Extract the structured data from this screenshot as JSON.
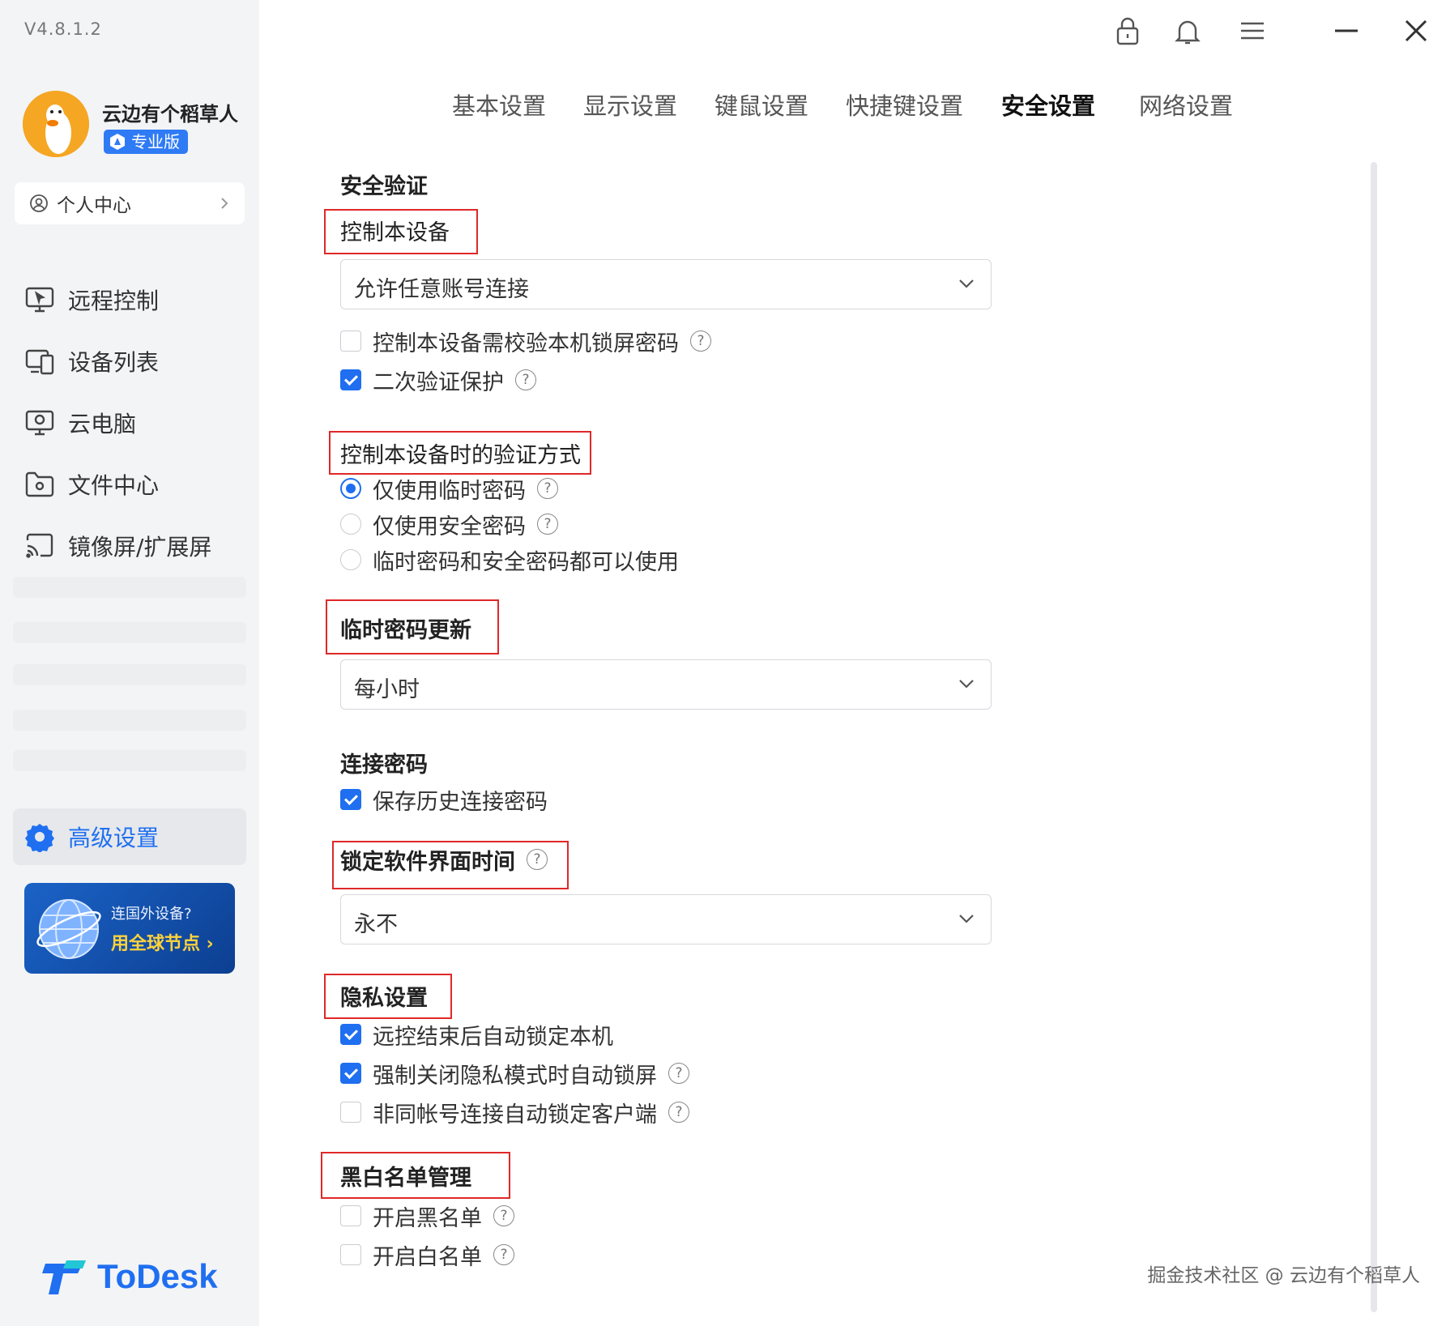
{
  "app": {
    "version": "V4.8.1.2",
    "logo_text": "ToDesk"
  },
  "user": {
    "name": "云边有个稻草人",
    "badge": "专业版",
    "profile_link": "个人中心"
  },
  "sidebar": {
    "items": [
      {
        "label": "远程控制",
        "icon": "remote-control-icon"
      },
      {
        "label": "设备列表",
        "icon": "device-list-icon"
      },
      {
        "label": "云电脑",
        "icon": "cloud-pc-icon"
      },
      {
        "label": "文件中心",
        "icon": "file-center-icon"
      },
      {
        "label": "镜像屏/扩展屏",
        "icon": "mirror-screen-icon"
      }
    ],
    "active_item": {
      "label": "高级设置",
      "icon": "gear-icon"
    },
    "promo": {
      "line1": "连国外设备?",
      "line2": "用全球节点 ›"
    }
  },
  "tabs": [
    {
      "label": "基本设置"
    },
    {
      "label": "显示设置"
    },
    {
      "label": "键鼠设置"
    },
    {
      "label": "快捷键设置"
    },
    {
      "label": "安全设置",
      "active": true
    },
    {
      "label": "网络设置"
    }
  ],
  "security": {
    "section1_title": "安全验证",
    "control_device_label": "控制本设备",
    "control_device_value": "允许任意账号连接",
    "opt_lock_pwd": {
      "label": "控制本设备需校验本机锁屏密码",
      "checked": false
    },
    "opt_2fa": {
      "label": "二次验证保护",
      "checked": true
    },
    "verify_method_label": "控制本设备时的验证方式",
    "verify_methods": [
      {
        "label": "仅使用临时密码",
        "selected": true
      },
      {
        "label": "仅使用安全密码",
        "selected": false
      },
      {
        "label": "临时密码和安全密码都可以使用",
        "selected": false
      }
    ],
    "temp_pwd_update_title": "临时密码更新",
    "temp_pwd_update_value": "每小时",
    "conn_pwd_title": "连接密码",
    "opt_save_history": {
      "label": "保存历史连接密码",
      "checked": true
    },
    "lock_ui_title": "锁定软件界面时间",
    "lock_ui_value": "永不",
    "privacy_title": "隐私设置",
    "privacy_opts": [
      {
        "label": "远控结束后自动锁定本机",
        "checked": true
      },
      {
        "label": "强制关闭隐私模式时自动锁屏",
        "checked": true
      },
      {
        "label": "非同帐号连接自动锁定客户端",
        "checked": false
      }
    ],
    "blackwhite_title": "黑白名单管理",
    "bw_opts": [
      {
        "label": "开启黑名单",
        "checked": false
      },
      {
        "label": "开启白名单",
        "checked": false
      }
    ]
  },
  "watermark": "掘金技术社区 @ 云边有个稻草人",
  "help_glyph": "?",
  "colors": {
    "accent": "#1f6ff0",
    "highlight_box": "#e02828",
    "promo_text": "#ffd23c"
  }
}
